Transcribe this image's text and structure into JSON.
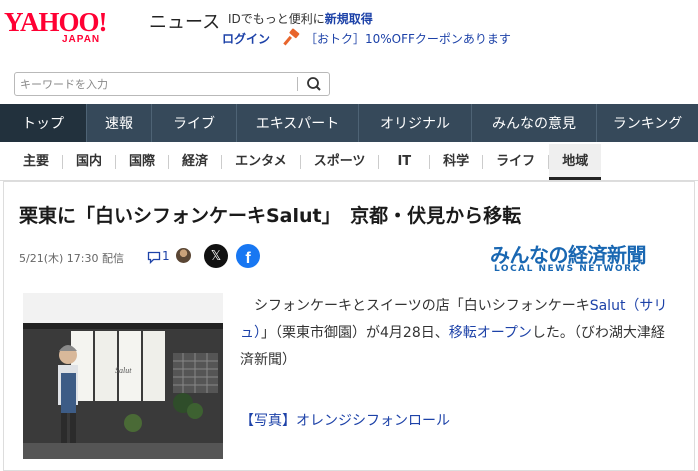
{
  "header": {
    "logo_main": "YAHOO!",
    "logo_sub": "JAPAN",
    "logo_section": "ニュース",
    "promo_text": "IDでもっと便利に",
    "promo_link": "新規取得",
    "login_label": "ログイン",
    "coupon_text": "［おトク］10%OFFクーポンあります"
  },
  "search": {
    "placeholder": "キーワードを入力"
  },
  "global_nav": [
    {
      "label": "トップ",
      "active": true
    },
    {
      "label": "速報"
    },
    {
      "label": "ライブ"
    },
    {
      "label": "エキスパート"
    },
    {
      "label": "オリジナル"
    },
    {
      "label": "みんなの意見"
    },
    {
      "label": "ランキング"
    }
  ],
  "category_nav": [
    {
      "label": "主要"
    },
    {
      "label": "国内"
    },
    {
      "label": "国際"
    },
    {
      "label": "経済"
    },
    {
      "label": "エンタメ"
    },
    {
      "label": "スポーツ"
    },
    {
      "label": "IT"
    },
    {
      "label": "科学"
    },
    {
      "label": "ライフ"
    },
    {
      "label": "地域",
      "active": true
    }
  ],
  "article": {
    "headline": "栗東に「白いシフォンケーキSalut」　京都・伏見から移転",
    "date": "5/21(木) 17:30 配信",
    "comment_count": "1",
    "share_x": "𝕏",
    "share_fb": "f",
    "source_logo": "みんなの経済新聞",
    "source_sub": "LOCAL NEWS NETWORK",
    "body_part1": "シフォンケーキとスイーツの店「白いシフォンケーキ",
    "body_link1": "Salut（サリュ）",
    "body_part2": "」（栗東市御園）が4月28日、",
    "body_link2": "移転オープン",
    "body_part3": "した。（びわ湖大津経済新聞）",
    "photo_link": "【写真】オレンジシフォンロール",
    "photo_sign": "Salut"
  },
  "colors": {
    "brand_red": "#ff0033",
    "nav_bg": "#36495a",
    "link_blue": "#1d42a8"
  }
}
